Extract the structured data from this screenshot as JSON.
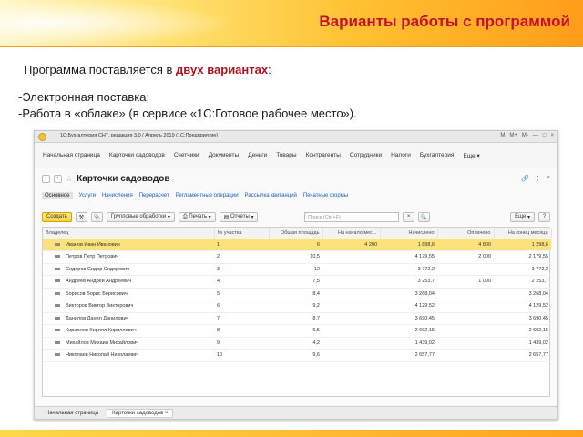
{
  "slide": {
    "title": "Варианты работы с программой",
    "intro_before": "Программа поставляется в ",
    "intro_highlight": "двух вариантах",
    "intro_after": ":",
    "bullets": [
      "-Электронная поставка;",
      "-Работа в «облаке» (в сервисе «1С:Готовое рабочее место»)."
    ]
  },
  "app": {
    "window_title": "1С:Бухгалтерия СНТ, редакция 3.0 / Апрель 2019 (1С:Предприятие)",
    "title_controls": [
      "M",
      "M+",
      "M-",
      "—",
      "□",
      "×"
    ],
    "sections": [
      "Начальная страница",
      "Карточки садоводов",
      "Счетчики",
      "Документы",
      "Деньги",
      "Товары",
      "Контрагенты",
      "Сотрудники",
      "Налоги",
      "Бухгалтерия",
      "Еще"
    ],
    "form_title": "Карточки садоводов",
    "form_tabs": [
      "Основное",
      "Услуги",
      "Начисления",
      "Перерасчет",
      "Регламентные операции",
      "Рассылка квитанций",
      "Печатные формы"
    ],
    "toolbar": {
      "create": "Создать",
      "group_processing": "Групповые обработки",
      "print": "Печать",
      "reports": "Отчеты",
      "search_placeholder": "Поиск (Ctrl+F)",
      "more": "Еще"
    },
    "table": {
      "columns": [
        "Владелец",
        "№ участка",
        "Общая площадь",
        "На начало мес...",
        "Начислено",
        "Оплачено",
        "На конец месяца"
      ],
      "rows": [
        [
          "Иванов Иван Иванович",
          "1",
          "6",
          "4 200",
          "1 898,6",
          "4 800",
          "1 298,6"
        ],
        [
          "Петров Петр Петрович",
          "2",
          "10,5",
          "",
          "4 179,55",
          "2 000",
          "2 179,55"
        ],
        [
          "Сидоров Сидор Сидорович",
          "3",
          "12",
          "",
          "3 772,2",
          "",
          "3 772,2"
        ],
        [
          "Андреев Андрей Андреевич",
          "4",
          "7,5",
          "",
          "3 253,7",
          "1 000",
          "2 253,7"
        ],
        [
          "Борисов Борис Борисович",
          "5",
          "8,4",
          "",
          "3 268,04",
          "",
          "3 268,04"
        ],
        [
          "Викторов Виктор Викторович",
          "6",
          "9,2",
          "",
          "4 129,52",
          "",
          "4 129,52"
        ],
        [
          "Данилов Данил Данилович",
          "7",
          "8,7",
          "",
          "3 690,45",
          "",
          "3 690,45"
        ],
        [
          "Кириллов Кирилл Кириллович",
          "8",
          "6,5",
          "",
          "2 692,15",
          "",
          "2 692,15"
        ],
        [
          "Михайлов Михаил Михайлович",
          "9",
          "4,2",
          "",
          "1 439,02",
          "",
          "1 439,02"
        ],
        [
          "Николаев Николай Николаевич",
          "10",
          "9,6",
          "",
          "2 657,77",
          "",
          "2 657,77"
        ]
      ]
    },
    "open_tabs": [
      "Начальная страница",
      "Карточки садоводов"
    ]
  }
}
